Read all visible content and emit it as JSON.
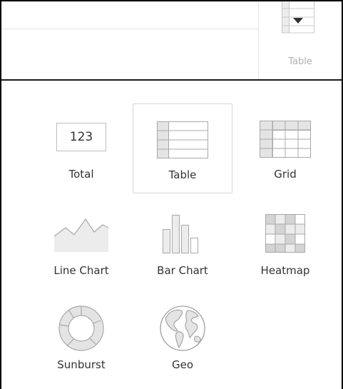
{
  "toolbar": {
    "active_view_label": "Table"
  },
  "chart_types": [
    {
      "key": "total",
      "label": "Total",
      "icon": "total-icon",
      "value_text": "123",
      "selected": false
    },
    {
      "key": "table",
      "label": "Table",
      "icon": "table-icon",
      "selected": true
    },
    {
      "key": "grid",
      "label": "Grid",
      "icon": "grid-icon",
      "selected": false
    },
    {
      "key": "line",
      "label": "Line Chart",
      "icon": "line-chart-icon",
      "selected": false
    },
    {
      "key": "bar",
      "label": "Bar Chart",
      "icon": "bar-chart-icon",
      "selected": false
    },
    {
      "key": "heatmap",
      "label": "Heatmap",
      "icon": "heatmap-icon",
      "selected": false
    },
    {
      "key": "sunburst",
      "label": "Sunburst",
      "icon": "sunburst-icon",
      "selected": false
    },
    {
      "key": "geo",
      "label": "Geo",
      "icon": "globe-icon",
      "selected": false
    }
  ],
  "colors": {
    "icon_fill": "#e8e8e8",
    "icon_dark": "#cfcfcf",
    "icon_stroke": "#a8a8a8",
    "selected_border": "#d6d6d6",
    "caption_muted": "#b0b0b0",
    "label": "#333333"
  }
}
